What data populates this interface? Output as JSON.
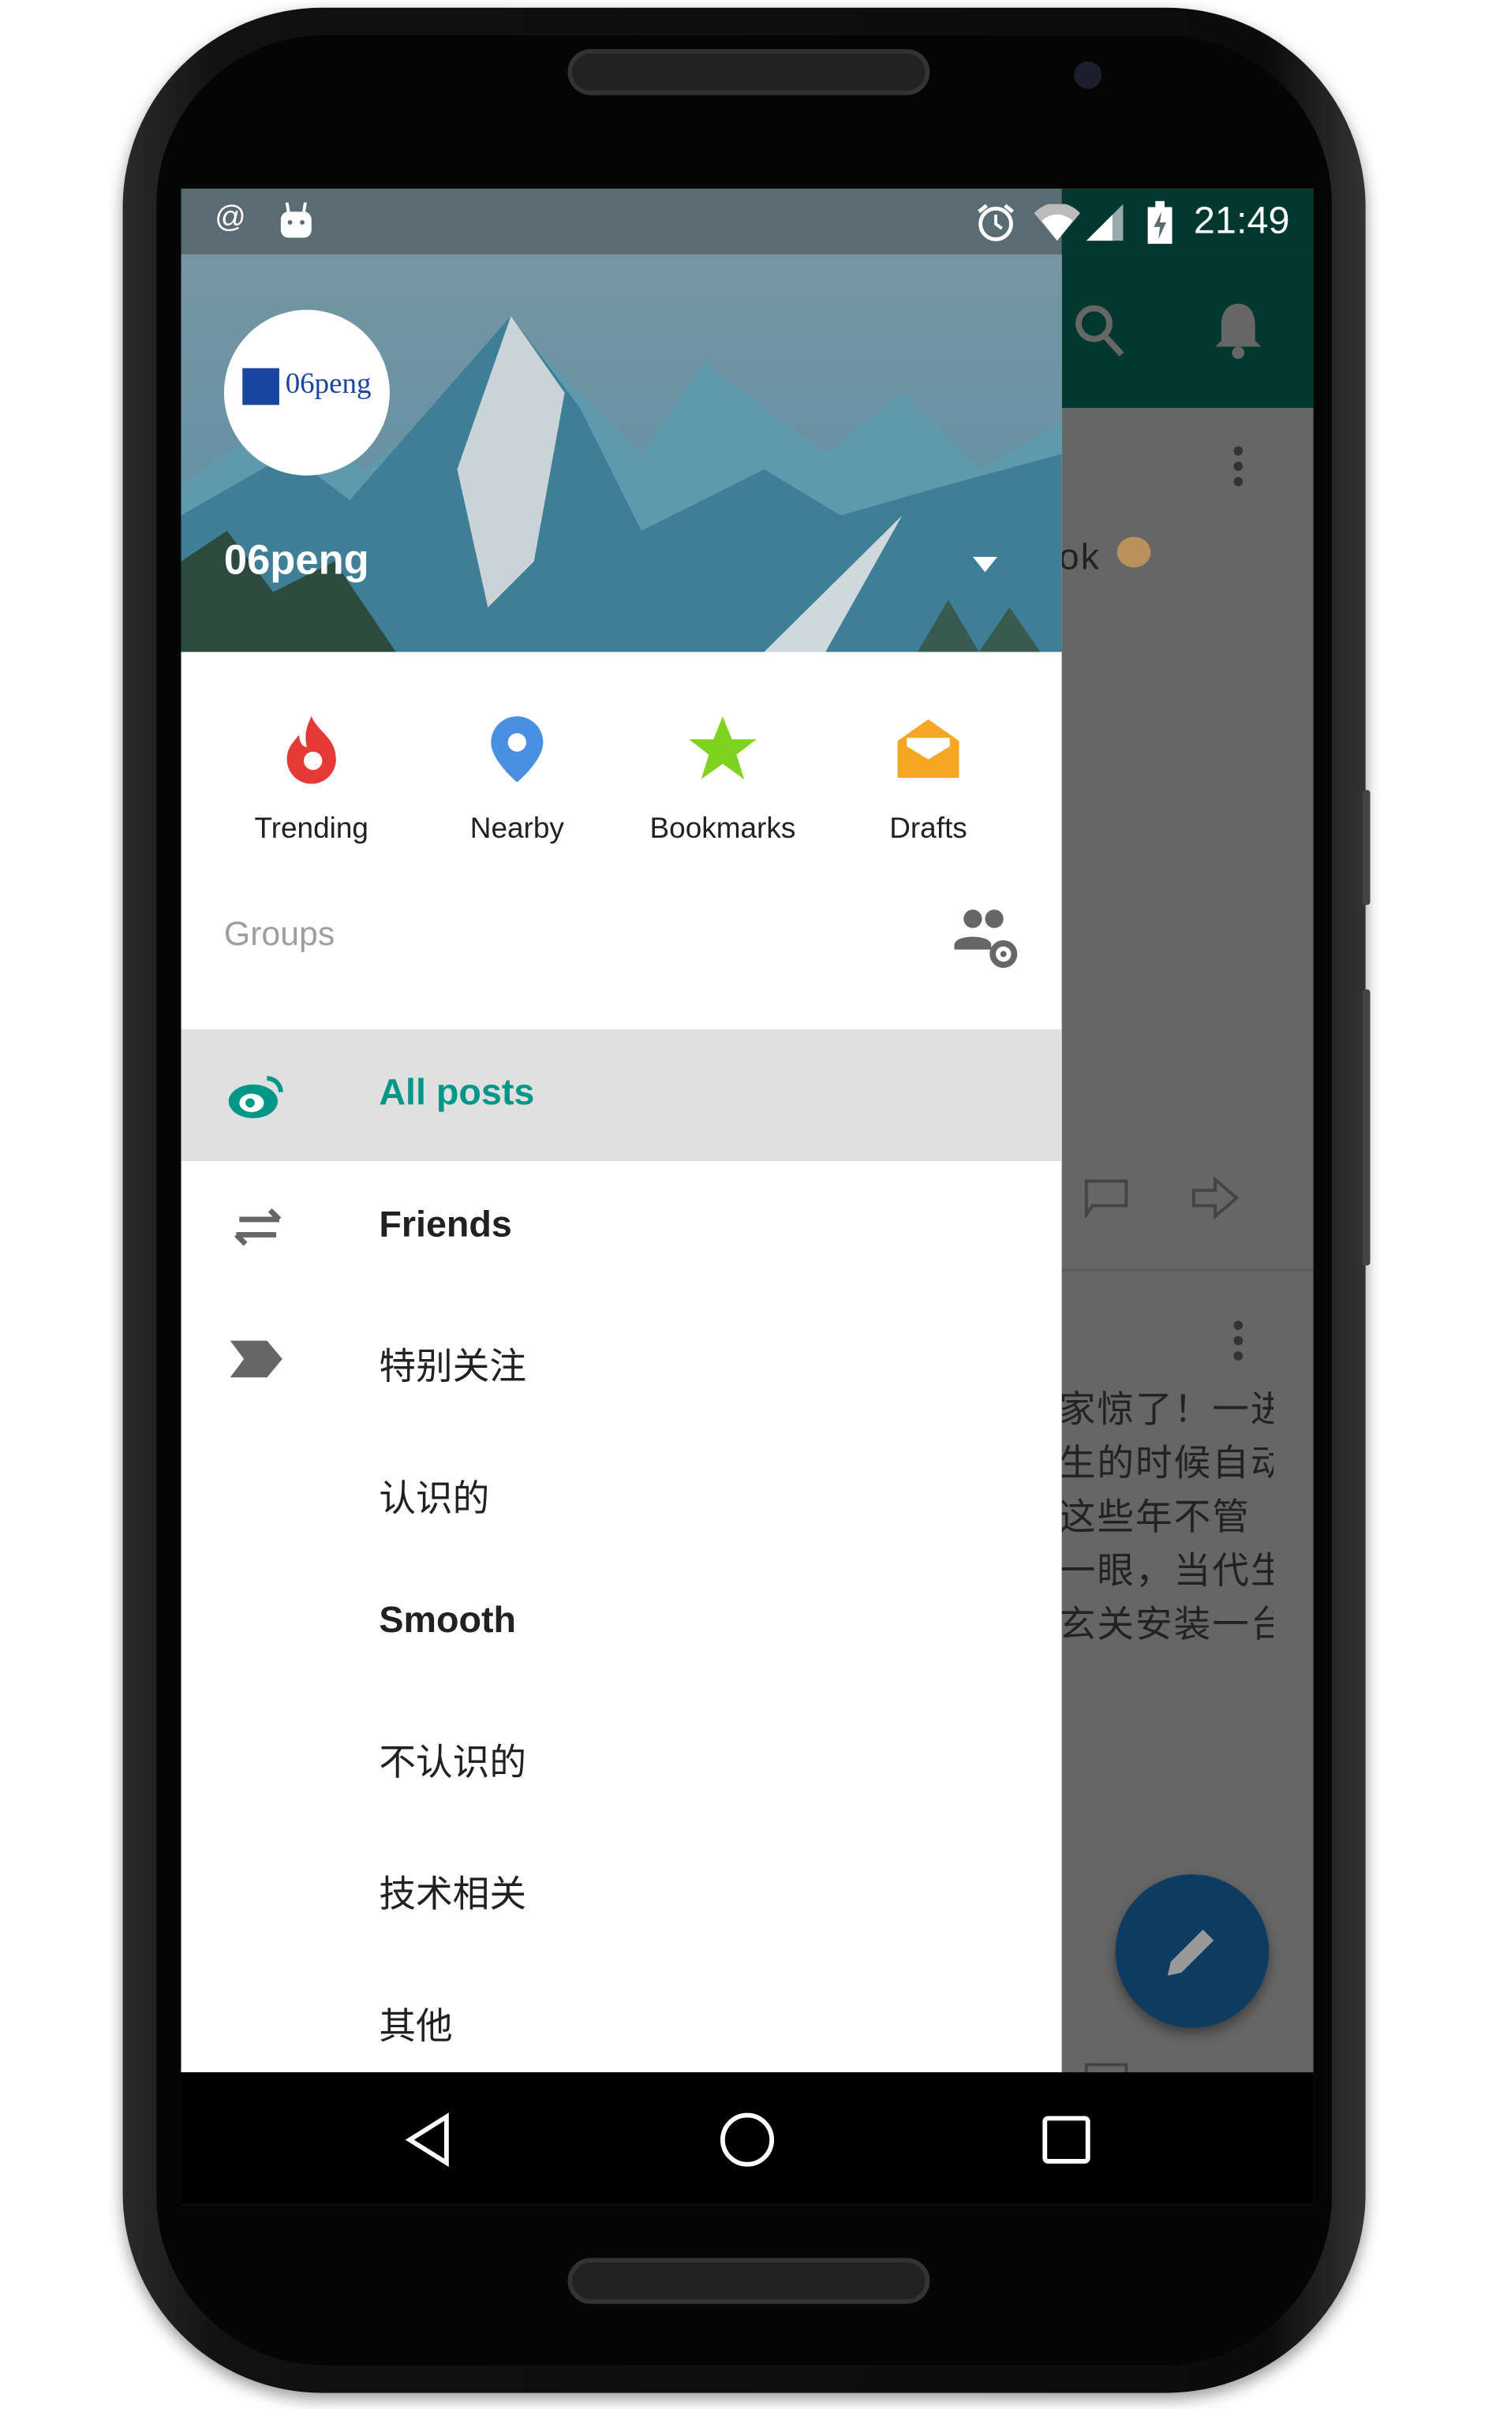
{
  "status_bar": {
    "time": "21:49",
    "left_icons": [
      "at-icon",
      "android-icon"
    ],
    "right_icons": [
      "alarm-icon",
      "wifi-icon",
      "signal-icon",
      "battery-charging-icon"
    ]
  },
  "toolbar": {
    "icons": [
      "search-icon",
      "bell-icon"
    ],
    "color": "#004d40"
  },
  "drawer": {
    "account": {
      "name": "06peng",
      "avatar_text": "06peng"
    },
    "shortcuts": [
      {
        "label": "Trending",
        "icon": "flame-icon",
        "color": "#e53935"
      },
      {
        "label": "Nearby",
        "icon": "location-pin-icon",
        "color": "#4a90e2"
      },
      {
        "label": "Bookmarks",
        "icon": "star-icon",
        "color": "#7ed321"
      },
      {
        "label": "Drafts",
        "icon": "envelope-open-icon",
        "color": "#f5a623"
      }
    ],
    "groups_label": "Groups",
    "items": [
      {
        "label": "All posts",
        "icon": "weibo-icon",
        "selected": true
      },
      {
        "label": "Friends",
        "icon": "swap-arrows-icon"
      },
      {
        "label": "特别关注",
        "icon": "label-tag-icon"
      },
      {
        "label": "认识的"
      },
      {
        "label": "Smooth"
      },
      {
        "label": "不认识的"
      },
      {
        "label": "技术相关"
      },
      {
        "label": "其他"
      }
    ],
    "accent": "#009688"
  },
  "feed": {
    "post1_text": "ok",
    "post2_text": "家惊了！一进\n生的时候自动\n这些年不管\n一眼，当代生\n玄关安装一台"
  }
}
